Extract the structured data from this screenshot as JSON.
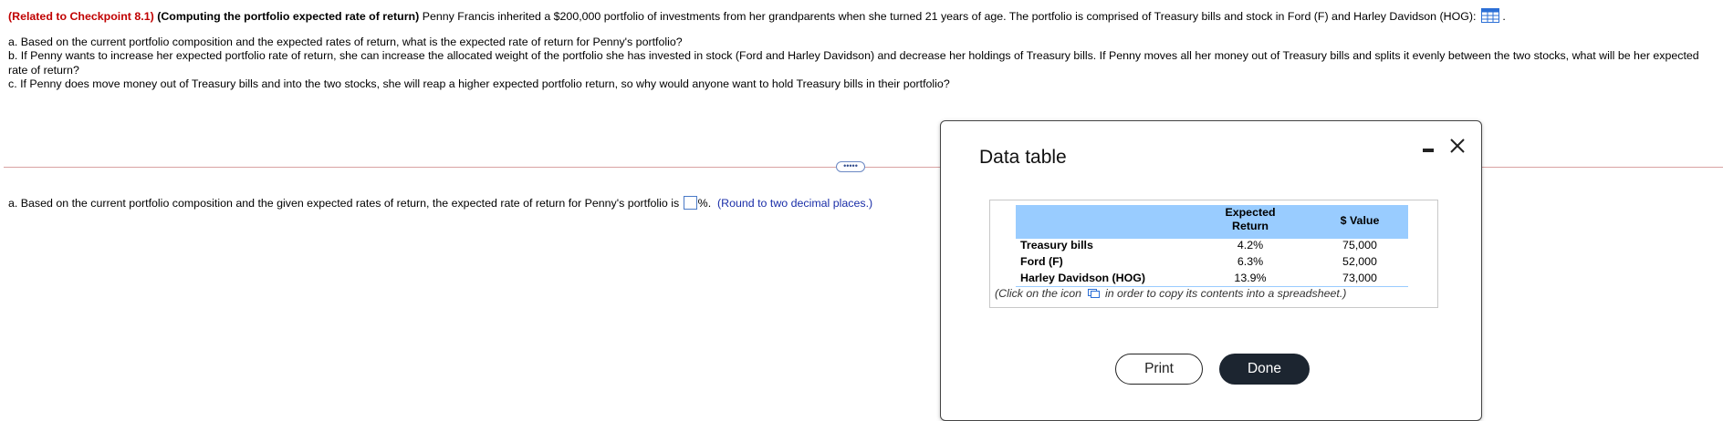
{
  "question": {
    "checkpoint": "(Related to Checkpoint 8.1)",
    "topic": "(Computing the portfolio expected rate of return)",
    "intro": "Penny Francis inherited a $200,000 portfolio of investments from her grandparents when she turned 21 years of age. The portfolio is comprised of Treasury bills and stock in Ford (F) and Harley Davidson (HOG):",
    "intro_end": ".",
    "part_a": "a. Based on the current portfolio composition and the expected rates of return, what is the expected rate of return for Penny's portfolio?",
    "part_b": "b. If Penny wants to increase her expected portfolio rate of return, she can increase the allocated weight of the portfolio she has invested in stock (Ford and Harley Davidson) and decrease her holdings of Treasury bills. If Penny moves all her money out of Treasury bills and splits it evenly between the two stocks, what will be her expected rate of return?",
    "part_c": "c. If Penny does move money out of Treasury bills and into the two stocks, she will reap a higher expected portfolio return, so why would anyone want to hold Treasury bills in their portfolio?"
  },
  "more_button": "•••••",
  "answer": {
    "prefix": "a. Based on the current portfolio composition and the given expected rates of return, the expected rate of return for Penny's portfolio is",
    "input_value": "",
    "suffix": "%.",
    "hint": "(Round to two decimal places.)"
  },
  "modal": {
    "title": "Data table",
    "table": {
      "headers": [
        "Expected Return",
        "$ Value"
      ],
      "header_line1": "Expected",
      "header_line2": "Return",
      "rows": [
        {
          "label": "Treasury bills",
          "expected_return": "4.2%",
          "value": "75,000"
        },
        {
          "label": "Ford (F)",
          "expected_return": "6.3%",
          "value": "52,000"
        },
        {
          "label": "Harley Davidson (HOG)",
          "expected_return": "13.9%",
          "value": "73,000"
        }
      ]
    },
    "copy_note_before": "(Click on the icon",
    "copy_note_after": "in order to copy its contents into a spreadsheet.)",
    "print_label": "Print",
    "done_label": "Done"
  },
  "icons": {
    "table": "table-grid-icon",
    "copy": "copy-icon",
    "minimize": "minimize-icon",
    "close": "close-icon"
  },
  "colors": {
    "checkpoint": "#c00000",
    "hint": "#1a2ea8",
    "table_header": "#99ccff",
    "done_button": "#1c2530"
  }
}
